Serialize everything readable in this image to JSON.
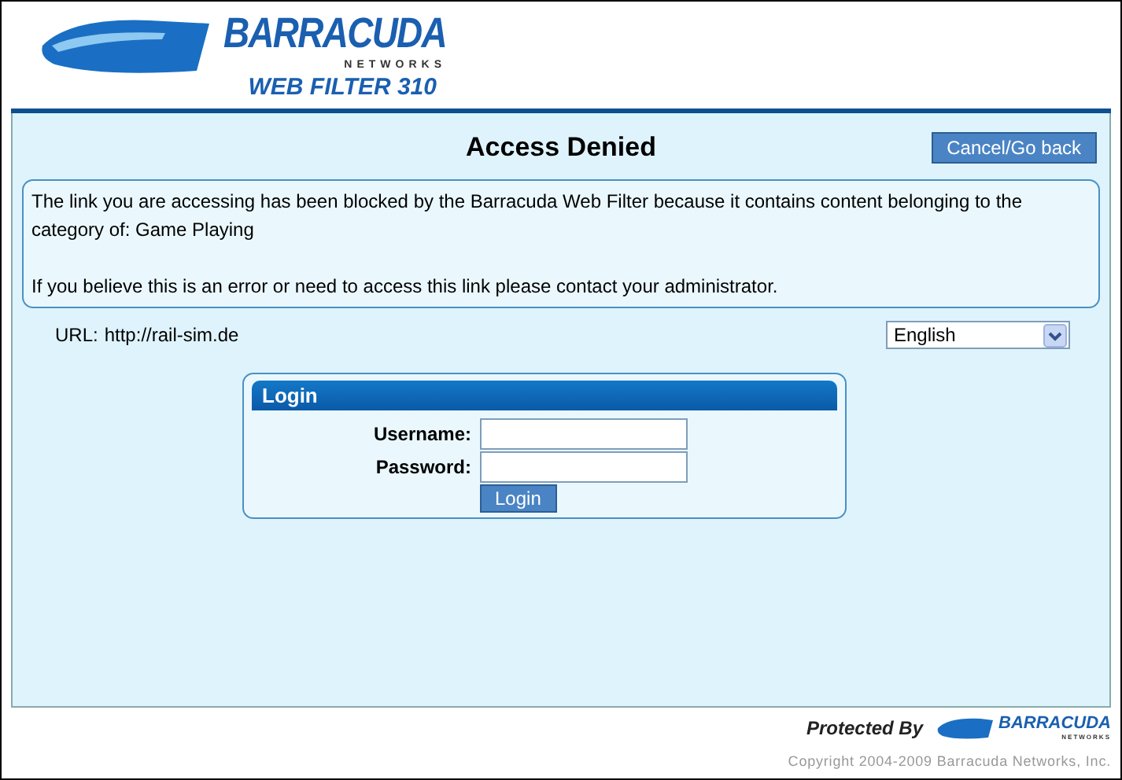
{
  "logo": {
    "brand": "BARRACUDA",
    "sub": "NETWORKS",
    "product": "WEB FILTER 310"
  },
  "title": "Access Denied",
  "cancel_button": "Cancel/Go back",
  "message": {
    "lines": [
      "The link you are accessing has been blocked by the Barracuda Web Filter because it contains content belonging to the category of: Game Playing",
      "If you believe this is an error or need to access this link please contact your administrator."
    ]
  },
  "url": {
    "label": "URL:",
    "value": "http://rail-sim.de"
  },
  "language": {
    "value": "English"
  },
  "login": {
    "title": "Login",
    "username_label": "Username:",
    "password_label": "Password:",
    "button": "Login"
  },
  "footer": {
    "protected_by": "Protected By",
    "brand": "BARRACUDA",
    "sub": "NETWORKS",
    "copyright": "Copyright 2004-2009 Barracuda Networks, Inc."
  }
}
